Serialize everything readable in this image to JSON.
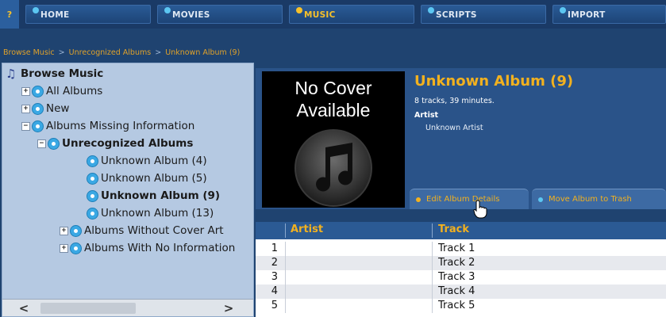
{
  "nav": {
    "help": "?",
    "tabs": [
      {
        "label": "HOME",
        "active": false
      },
      {
        "label": "MOVIES",
        "active": false
      },
      {
        "label": "MUSIC",
        "active": true
      },
      {
        "label": "SCRIPTS",
        "active": false
      },
      {
        "label": "IMPORT",
        "active": false
      }
    ]
  },
  "breadcrumb": [
    "Browse Music",
    "Unrecognized Albums",
    "Unknown Album (9)"
  ],
  "breadcrumb_sep": ">",
  "tree": {
    "root": "Browse Music",
    "items": [
      {
        "label": "All Albums",
        "expander": "+"
      },
      {
        "label": "New",
        "expander": "+"
      },
      {
        "label": "Albums Missing Information",
        "expander": "−"
      },
      {
        "label": "Unrecognized Albums",
        "expander": "−"
      },
      {
        "label": "Unknown Album (4)"
      },
      {
        "label": "Unknown Album (5)"
      },
      {
        "label": "Unknown Album (9)"
      },
      {
        "label": "Unknown Album (13)"
      },
      {
        "label": "Albums Without Cover Art",
        "expander": "+"
      },
      {
        "label": "Albums With No Information",
        "expander": "+"
      }
    ],
    "scroll_left": "<",
    "scroll_right": ">"
  },
  "cover": {
    "line1": "No Cover",
    "line2": "Available"
  },
  "album": {
    "title": "Unknown Album (9)",
    "meta": "8 tracks, 39 minutes.",
    "artist_heading": "Artist",
    "artist": "Unknown Artist"
  },
  "actions": {
    "edit": "Edit Album Details",
    "trash": "Move Album to Trash"
  },
  "table": {
    "columns": [
      "Artist",
      "Track"
    ],
    "rows": [
      {
        "n": "1",
        "artist": "",
        "track": "Track 1"
      },
      {
        "n": "2",
        "artist": "",
        "track": "Track 2"
      },
      {
        "n": "3",
        "artist": "",
        "track": "Track 3"
      },
      {
        "n": "4",
        "artist": "",
        "track": "Track 4"
      },
      {
        "n": "5",
        "artist": "",
        "track": "Track 5"
      }
    ]
  },
  "colors": {
    "accent": "#f2b11f",
    "nav_dot": "#5cc7f2",
    "background": "#1f4370"
  }
}
